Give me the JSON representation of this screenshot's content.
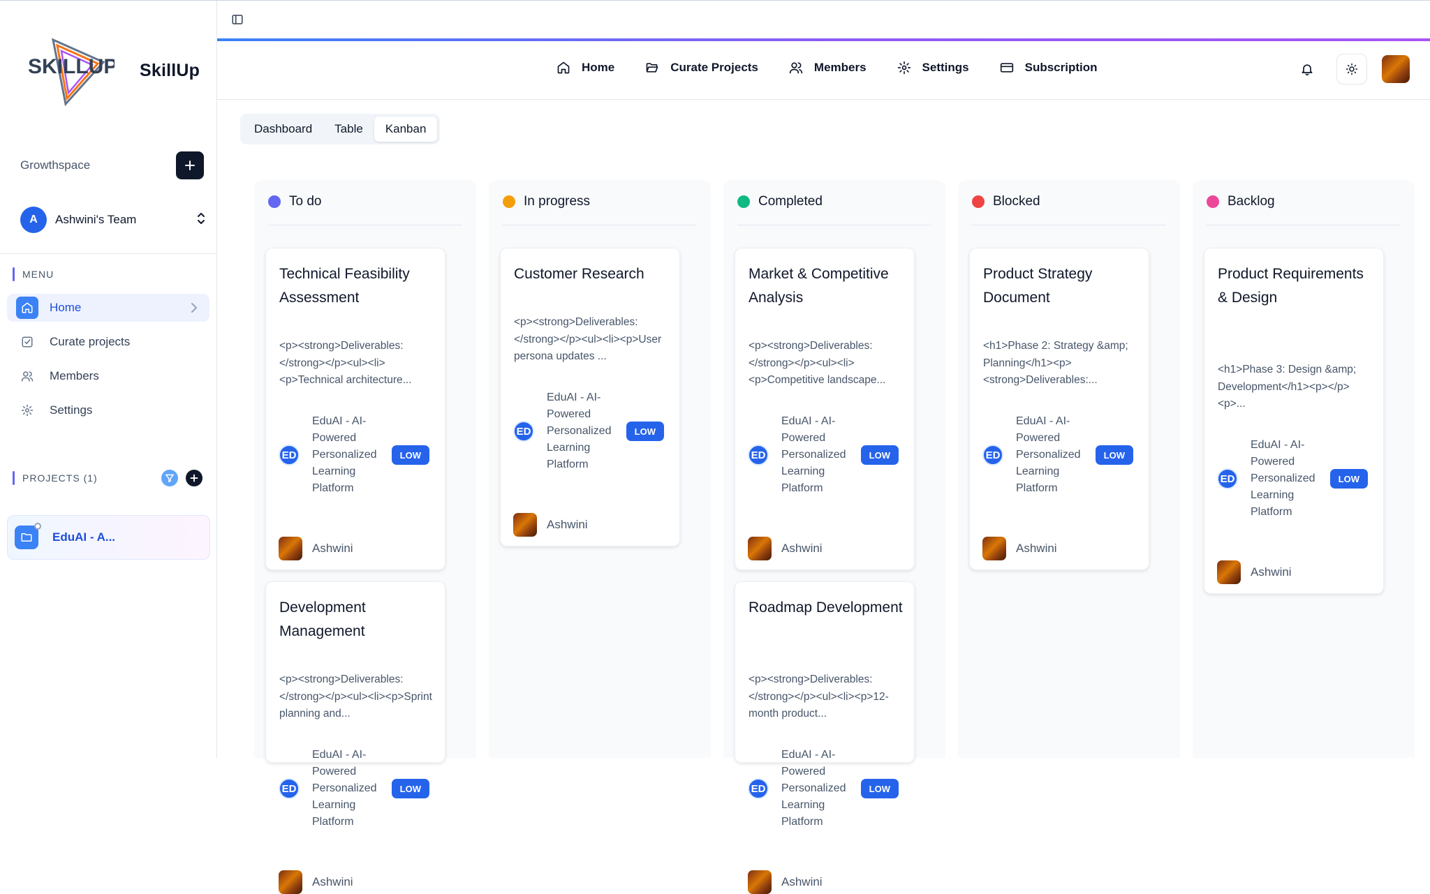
{
  "sidebar": {
    "brand": "SkillUp",
    "logo_text": "SKILLUP",
    "growthspace_label": "Growthspace",
    "team": {
      "initial": "A",
      "name": "Ashwini's Team"
    },
    "menu_label": "MENU",
    "menu_items": [
      {
        "label": "Home",
        "icon": "home-icon",
        "active": true
      },
      {
        "label": "Curate projects",
        "icon": "checkbox-icon",
        "active": false
      },
      {
        "label": "Members",
        "icon": "users-icon",
        "active": false
      },
      {
        "label": "Settings",
        "icon": "gear-icon",
        "active": false
      }
    ],
    "projects_label": "PROJECTS (1)",
    "projects": [
      {
        "name": "EduAI - A...",
        "icon": "folder-icon"
      }
    ]
  },
  "header": {
    "nav": [
      {
        "label": "Home",
        "icon": "home-icon"
      },
      {
        "label": "Curate Projects",
        "icon": "folder-open-icon"
      },
      {
        "label": "Members",
        "icon": "users-icon"
      },
      {
        "label": "Settings",
        "icon": "gear-icon"
      },
      {
        "label": "Subscription",
        "icon": "credit-card-icon"
      }
    ]
  },
  "view_tabs": [
    {
      "label": "Dashboard",
      "active": false
    },
    {
      "label": "Table",
      "active": false
    },
    {
      "label": "Kanban",
      "active": true
    }
  ],
  "project_name": "EduAI - AI-Powered Personalized Learning Platform",
  "project_lines": [
    "EduAI - AI-",
    "Powered",
    "Personalized",
    "Learning",
    "Platform"
  ],
  "project_badge": "ED",
  "priority": "LOW",
  "assignee": "Ashwini",
  "columns": [
    {
      "title": "To do",
      "color": "#6366f1",
      "cards": [
        {
          "title": "Technical Feasibility Assessment",
          "desc": "<p><strong>Deliverables:</strong></p><ul><li><p>Technical architecture..."
        },
        {
          "title": "Development Management",
          "desc": "<p><strong>Deliverables:</strong></p><ul><li><p>Sprint planning and..."
        }
      ]
    },
    {
      "title": "In progress",
      "color": "#f59e0b",
      "cards": [
        {
          "title": "Customer Research",
          "desc": "<p><strong>Deliverables:</strong></p><ul><li><p>User persona updates ..."
        }
      ]
    },
    {
      "title": "Completed",
      "color": "#10b981",
      "cards": [
        {
          "title": "Market & Competitive Analysis",
          "desc": "<p><strong>Deliverables:</strong></p><ul><li><p>Competitive landscape..."
        },
        {
          "title": "Roadmap Development",
          "desc": "<p><strong>Deliverables:</strong></p><ul><li><p>12-month product..."
        }
      ]
    },
    {
      "title": "Blocked",
      "color": "#ef4444",
      "cards": [
        {
          "title": "Product Strategy Document",
          "desc": "<h1>Phase 2: Strategy &amp; Planning</h1><p><strong>Deliverables:..."
        }
      ]
    },
    {
      "title": "Backlog",
      "color": "#ec4899",
      "cards": [
        {
          "title": "Product Requirements & Design",
          "desc": "<h1>Phase 3: Design &amp; Development</h1><p></p><p>..."
        }
      ]
    }
  ]
}
